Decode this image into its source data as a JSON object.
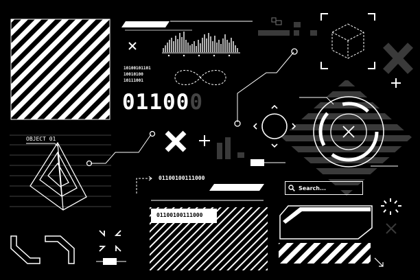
{
  "labels": {
    "object_label": "OBJECT 01",
    "binary_small_1": "10100101101",
    "binary_small_2": "10010100",
    "binary_small_3": "10111001",
    "binary_big": "01100",
    "binary_big_faded": "0",
    "binary_arrow": "01100100111000",
    "binary_box": "01100100111000",
    "search_placeholder": "Search..."
  },
  "icons": {
    "search": "magnifier-icon",
    "close": "x-icon",
    "plus": "plus-icon",
    "crosshair": "crosshair-icon",
    "cube": "cube-icon",
    "pyramid": "pyramid-icon",
    "infinity": "infinity-icon"
  },
  "colors": {
    "background": "#000000",
    "foreground": "#ffffff",
    "muted": "#3a3a3a"
  }
}
